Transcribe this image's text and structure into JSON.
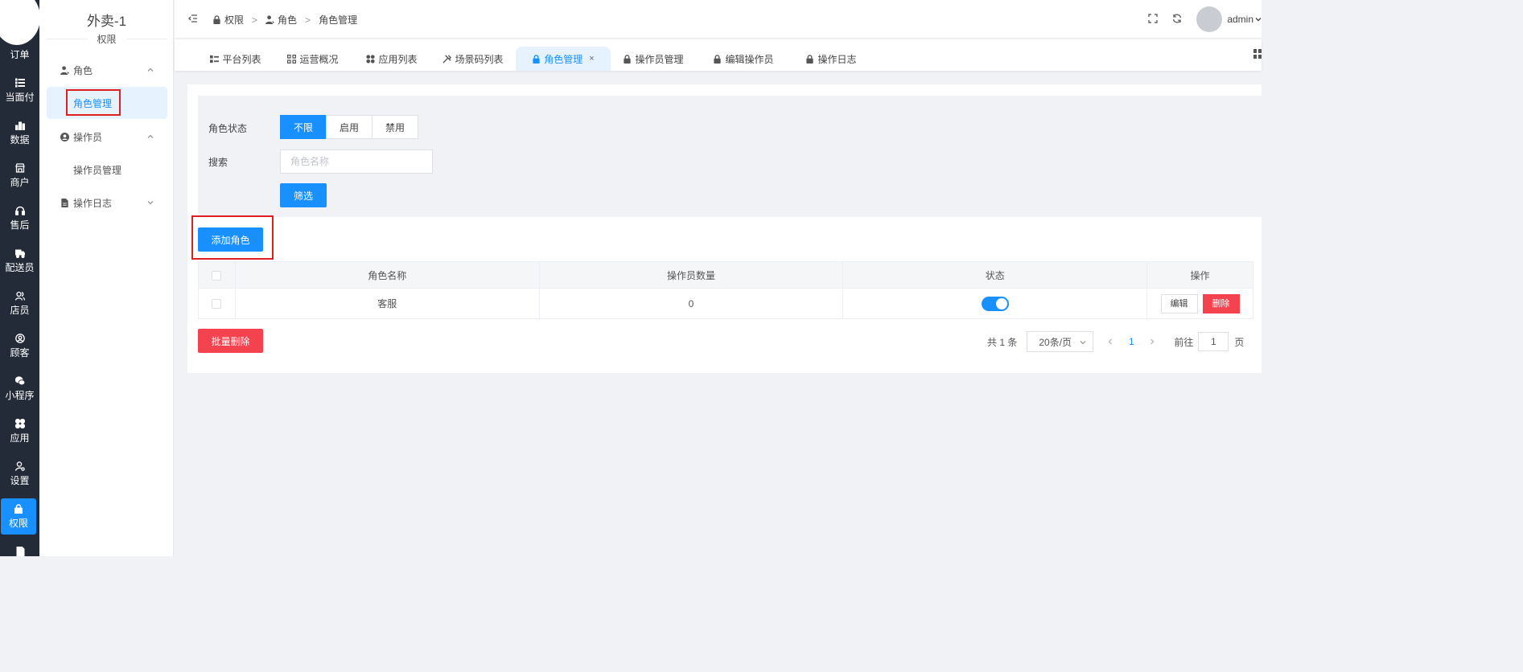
{
  "rail": {
    "items": [
      {
        "label": "订单",
        "icon": "order-icon"
      },
      {
        "label": "当面付",
        "icon": "list-icon"
      },
      {
        "label": "数据",
        "icon": "bar-chart-icon"
      },
      {
        "label": "商户",
        "icon": "store-icon"
      },
      {
        "label": "售后",
        "icon": "headset-icon"
      },
      {
        "label": "配送员",
        "icon": "delivery-icon"
      },
      {
        "label": "店员",
        "icon": "staff-icon"
      },
      {
        "label": "顾客",
        "icon": "customer-icon"
      },
      {
        "label": "小程序",
        "icon": "wechat-icon"
      },
      {
        "label": "应用",
        "icon": "apps-icon"
      },
      {
        "label": "设置",
        "icon": "settings-icon"
      },
      {
        "label": "权限",
        "icon": "lock-icon"
      }
    ],
    "active_label": "权限"
  },
  "sidebar": {
    "title": "外卖-1",
    "subtitle": "权限",
    "groups": [
      {
        "label": "角色",
        "icon": "user-tie-icon",
        "items": [
          {
            "label": "角色管理"
          }
        ]
      },
      {
        "label": "操作员",
        "icon": "user-circle-icon",
        "items": [
          {
            "label": "操作员管理"
          }
        ]
      },
      {
        "label": "操作日志",
        "icon": "file-icon",
        "items": []
      }
    ]
  },
  "header": {
    "breadcrumb": [
      "权限",
      "角色",
      "角色管理"
    ],
    "user": "admin"
  },
  "tabs": [
    {
      "label": "平台列表",
      "icon": "grid-list-icon"
    },
    {
      "label": "运营概况",
      "icon": "dashboard-icon"
    },
    {
      "label": "应用列表",
      "icon": "apps-icon"
    },
    {
      "label": "场景码列表",
      "icon": "tools-icon"
    },
    {
      "label": "角色管理",
      "icon": "lock-icon",
      "active": true
    },
    {
      "label": "操作员管理",
      "icon": "lock-icon"
    },
    {
      "label": "编辑操作员",
      "icon": "lock-icon"
    },
    {
      "label": "操作日志",
      "icon": "lock-icon"
    }
  ],
  "filter": {
    "status_label": "角色状态",
    "status_options": [
      "不限",
      "启用",
      "禁用"
    ],
    "status_selected": "不限",
    "search_label": "搜索",
    "search_placeholder": "角色名称",
    "search_value": "",
    "filter_button": "筛选"
  },
  "actions": {
    "add_role": "添加角色",
    "batch_delete": "批量删除"
  },
  "table": {
    "columns": [
      "角色名称",
      "操作员数量",
      "状态",
      "操作"
    ],
    "rows": [
      {
        "name": "客服",
        "operator_count": "0",
        "enabled": true,
        "edit": "编辑",
        "delete": "删除"
      }
    ]
  },
  "pagination": {
    "total_text": "共 1 条",
    "page_size": "20条/页",
    "current_page": "1",
    "goto_label": "前往",
    "goto_value": "1",
    "page_unit": "页"
  },
  "colors": {
    "primary": "#1890ff",
    "danger": "#f5424f",
    "rail_bg": "#232b38",
    "highlight_box": "#e02020"
  }
}
